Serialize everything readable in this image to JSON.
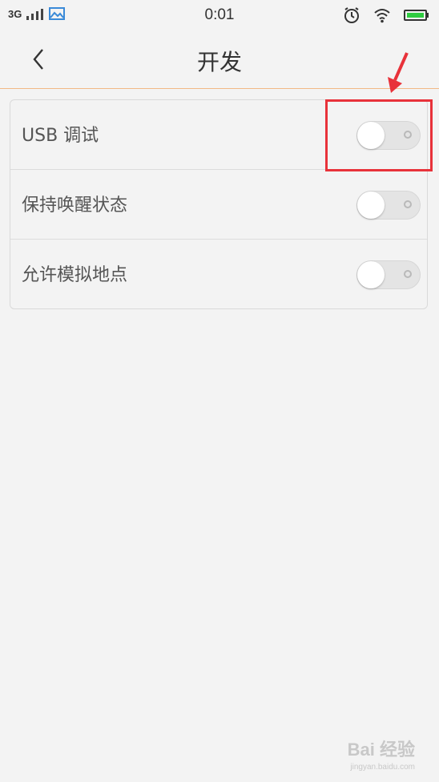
{
  "status_bar": {
    "network": "3G",
    "time": "0:01",
    "icons": [
      "signal-icon",
      "photo-icon",
      "alarm-icon",
      "wifi-icon",
      "battery-icon"
    ],
    "battery_color": "#2ecc40"
  },
  "header": {
    "back_icon": "chevron-left-icon",
    "title": "开发"
  },
  "settings": [
    {
      "label": "USB 调试",
      "enabled": false
    },
    {
      "label": "保持唤醒状态",
      "enabled": false
    },
    {
      "label": "允许模拟地点",
      "enabled": false
    }
  ],
  "annotation": {
    "color": "#e8323a"
  },
  "watermark": {
    "text": "Bai 经验",
    "url": "jingyan.baidu.com"
  },
  "colors": {
    "background": "#f3f3f3",
    "header_divider": "#f2b986"
  }
}
